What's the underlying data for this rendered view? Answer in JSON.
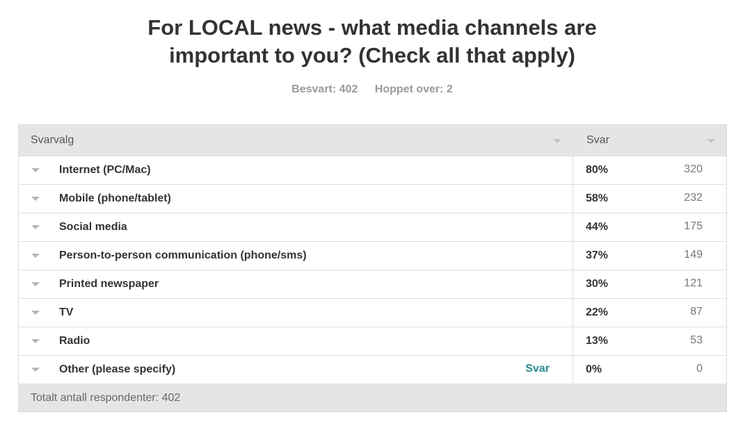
{
  "question": {
    "title_line1": "For LOCAL news - what media channels are",
    "title_line2": "important to you? (Check all that apply)"
  },
  "stats": {
    "answered": "Besvart: 402",
    "skipped": "Hoppet over: 2"
  },
  "table": {
    "col_choice": "Svarvalg",
    "col_answers": "Svar",
    "rows": [
      {
        "label": "Internet (PC/Mac)",
        "percent": "80%",
        "count": "320"
      },
      {
        "label": "Mobile (phone/tablet)",
        "percent": "58%",
        "count": "232"
      },
      {
        "label": "Social media",
        "percent": "44%",
        "count": "175"
      },
      {
        "label": "Person-to-person communication (phone/sms)",
        "percent": "37%",
        "count": "149"
      },
      {
        "label": "Printed newspaper",
        "percent": "30%",
        "count": "121"
      },
      {
        "label": "TV",
        "percent": "22%",
        "count": "87"
      },
      {
        "label": "Radio",
        "percent": "13%",
        "count": "53"
      },
      {
        "label": "Other (please specify)",
        "percent": "0%",
        "count": "0",
        "link": "Svar"
      }
    ],
    "footer": "Totalt antall respondenter: 402"
  }
}
